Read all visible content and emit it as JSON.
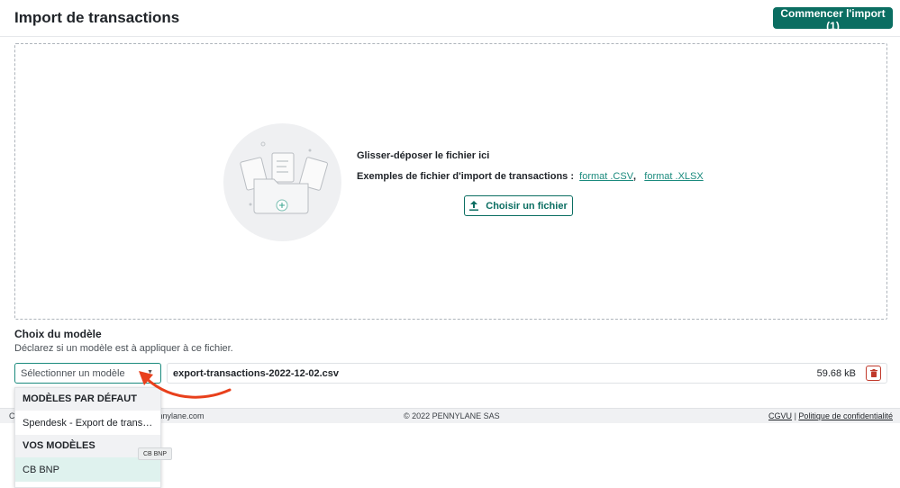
{
  "header": {
    "title": "Import de transactions",
    "start_button": "Commencer l'import (1)"
  },
  "dropzone": {
    "title": "Glisser-déposer le fichier ici",
    "examples_label": "Exemples de fichier d'import de transactions :",
    "link_csv": "format .CSV",
    "separator": ",",
    "link_xlsx": "format .XLSX",
    "choose_button": "Choisir un fichier"
  },
  "model": {
    "title": "Choix du modèle",
    "description": "Déclarez si un modèle est à appliquer à ce fichier.",
    "select_placeholder": "Sélectionner un modèle"
  },
  "file": {
    "name": "export-transactions-2022-12-02.csv",
    "size": "59.68 kB"
  },
  "dropdown": {
    "group_default": "MODÈLES PAR DÉFAUT",
    "option_default_1": "Spendesk - Export de transa...",
    "group_custom": "VOS MODÈLES",
    "option_custom_1": "CB BNP"
  },
  "tooltip": "CB BNP",
  "footer": {
    "left_prefix": "C",
    "left_partial": "ennylane.com",
    "center": "© 2022 PENNYLANE SAS",
    "cgvu": "CGVU",
    "separator": "|",
    "privacy": "Politique de confidentialité"
  },
  "colors": {
    "accent": "#0b6e62",
    "link": "#1a8a7d",
    "annotation_arrow": "#e8401c",
    "danger": "#c0392b"
  },
  "icons": {
    "upload": "upload-icon",
    "trash": "trash-icon",
    "caret": "caret-down-icon",
    "illustration": "file-folder-illustration"
  }
}
